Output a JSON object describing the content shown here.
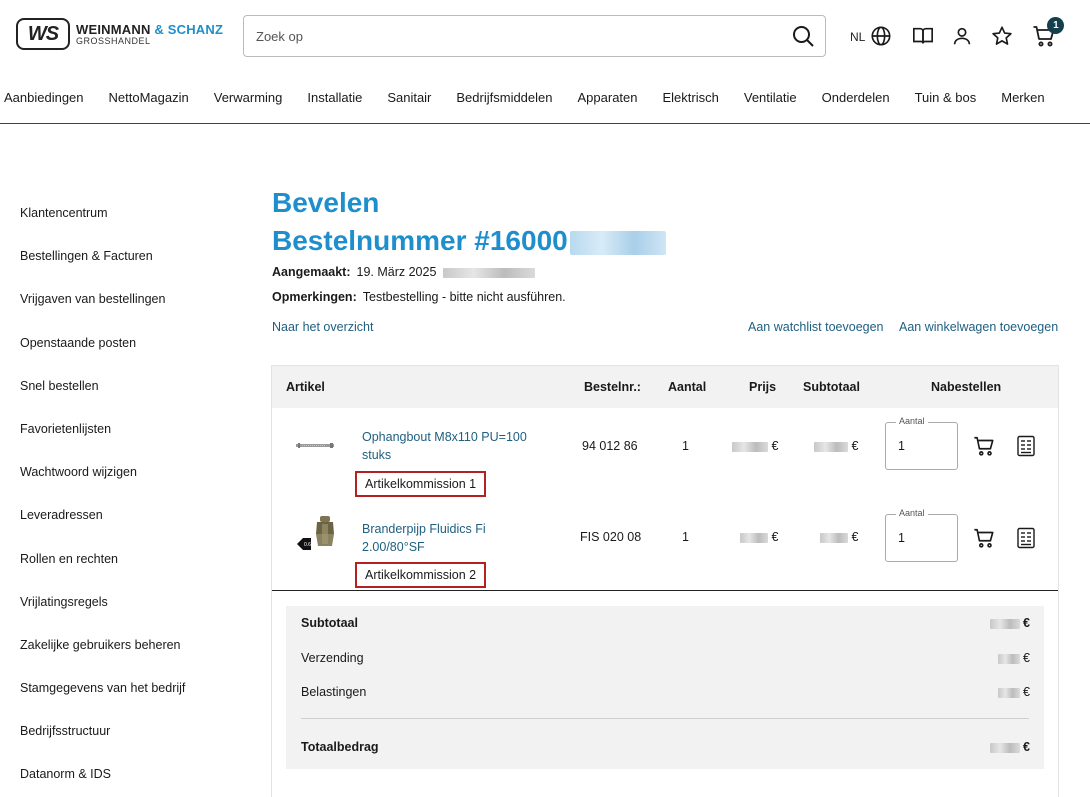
{
  "brand": {
    "mark": "WS",
    "name": "WEINMANN",
    "name_accent": "& SCHANZ",
    "sub": "GROSSHANDEL"
  },
  "search": {
    "placeholder": "Zoek op"
  },
  "header": {
    "lang": "NL",
    "cart_count": "1"
  },
  "nav": [
    "Aanbiedingen",
    "NettoMagazin",
    "Verwarming",
    "Installatie",
    "Sanitair",
    "Bedrijfsmiddelen",
    "Apparaten",
    "Elektrisch",
    "Ventilatie",
    "Onderdelen",
    "Tuin & bos",
    "Merken"
  ],
  "sidebar": [
    "Klantencentrum",
    "Bestellingen & Facturen",
    "Vrijgaven van bestellingen",
    "Openstaande posten",
    "Snel bestellen",
    "Favorietenlijsten",
    "Wachtwoord wijzigen",
    "Leveradressen",
    "Rollen en rechten",
    "Vrijlatingsregels",
    "Zakelijke gebruikers beheren",
    "Stamgegevens van het bedrijf",
    "Bedrijfsstructuur",
    "Datanorm & IDS"
  ],
  "page": {
    "title": "Bevelen",
    "order_prefix": "Bestelnummer #16000",
    "created_label": "Aangemaakt:",
    "created_value": "19. März 2025",
    "remarks_label": "Opmerkingen:",
    "remarks_value": "Testbestelling - bitte nicht ausführen.",
    "overview_link": "Naar het overzicht",
    "watchlist_link": "Aan watchlist toevoegen",
    "cart_link": "Aan winkelwagen toevoegen"
  },
  "table": {
    "headers": {
      "article": "Artikel",
      "ordernr": "Bestelnr.:",
      "qty": "Aantal",
      "price": "Prijs",
      "subtotal": "Subtotaal",
      "reorder": "Nabestellen"
    },
    "qty_field_label": "Aantal",
    "currency": "€",
    "rows": [
      {
        "name": "Ophangbout M8x110 PU=100 stuks",
        "komm": "Artikelkommission 1",
        "ordernr": "94 012 86",
        "qty": "1",
        "reorder_qty": "1"
      },
      {
        "name": "Branderpijp Fluidics Fi 2.00/80°SF",
        "komm": "Artikelkommission 2",
        "ordernr": "FIS 020 08",
        "qty": "1",
        "reorder_qty": "1"
      }
    ]
  },
  "totals": {
    "subtotal_label": "Subtotaal",
    "shipping_label": "Verzending",
    "taxes_label": "Belastingen",
    "total_label": "Totaalbedrag",
    "currency": "€"
  },
  "colors": {
    "brand_blue": "#1e8fcc",
    "link": "#1f5f80",
    "highlight": "#b22222",
    "dark": "#14404e"
  }
}
